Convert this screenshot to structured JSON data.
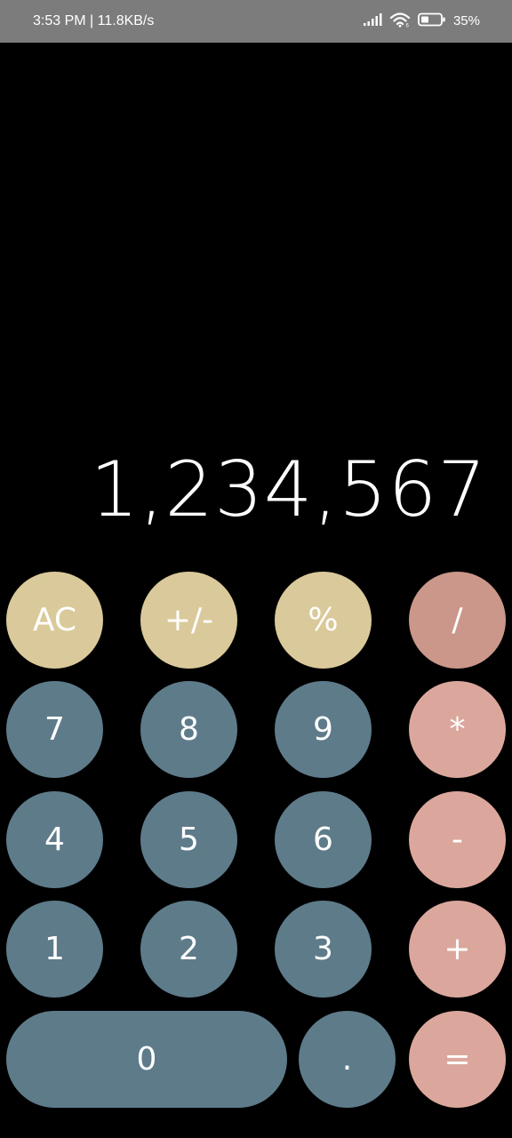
{
  "status_bar": {
    "time_speed": "3:53 PM | 11.8KB/s",
    "battery": "35%"
  },
  "display": {
    "value": "1,234,567"
  },
  "keys": {
    "ac": "AC",
    "sign": "+/-",
    "percent": "%",
    "divide": "/",
    "seven": "7",
    "eight": "8",
    "nine": "9",
    "multiply": "*",
    "four": "4",
    "five": "5",
    "six": "6",
    "subtract": "-",
    "one": "1",
    "two": "2",
    "three": "3",
    "add": "+",
    "zero": "0",
    "decimal": ".",
    "equals": "="
  },
  "icons": {
    "signal": "signal-icon",
    "wifi": "wifi-icon",
    "battery": "battery-icon"
  },
  "colors": {
    "function_keys": "#dac99a",
    "number_keys": "#5e7b8a",
    "operator_keys": "#dba79c",
    "divide_key": "#cb978a",
    "background": "#000000",
    "status_bar": "#7c7c7c"
  }
}
